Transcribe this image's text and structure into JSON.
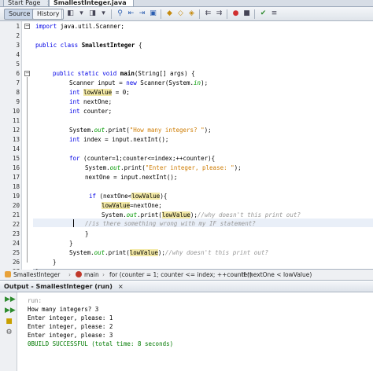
{
  "doc_tabs": [
    {
      "label": "Start Page",
      "close": "×"
    },
    {
      "label": "SmallestInteger.java",
      "close": "×"
    }
  ],
  "toolbar": {
    "source_label": "Source",
    "history_label": "History",
    "icons": [
      "back-icon",
      "forward-icon",
      "search-icon",
      "find-previous-icon",
      "find-next-icon",
      "toggle-highlight-icon",
      "bookmark-previous-icon",
      "bookmark-next-icon",
      "toggle-bookmark-icon",
      "shift-left-icon",
      "shift-right-icon",
      "record-macro-icon",
      "stop-macro-icon",
      "comment-icon",
      "uncomment-icon"
    ]
  },
  "editor": {
    "line_numbers": [
      "1",
      "2",
      "3",
      "4",
      "5",
      "6",
      "7",
      "8",
      "9",
      "10",
      "11",
      "12",
      "13",
      "14",
      "15",
      "16",
      "17",
      "18",
      "19",
      "20",
      "21",
      "22",
      "23",
      "24",
      "25",
      "26",
      "27"
    ]
  },
  "code": {
    "l1": {
      "kw": "import",
      "rest": " java.util.Scanner;"
    },
    "l3": {
      "kw": "public class",
      "name": " SmallestInteger ",
      "brace": "{"
    },
    "l6": {
      "kw": "public static void",
      "name": " main",
      "rest": "(String[] args) {"
    },
    "l7": {
      "a": "Scanner input = ",
      "kw": "new",
      "b": " Scanner(System.",
      "fld": "in",
      "c": ");"
    },
    "l8": {
      "kw": "int",
      "hl": "lowValue",
      "rest": " = 0;"
    },
    "l9": {
      "kw": "int",
      "rest": " nextOne;"
    },
    "l10": {
      "kw": "int",
      "rest": " counter;"
    },
    "l12": {
      "a": "System.",
      "fld": "out",
      "b": ".print(",
      "str": "\"How many integers? \"",
      "c": ");"
    },
    "l13": {
      "kw": "int",
      "rest": " index = input.nextInt();"
    },
    "l15": {
      "kw": "for",
      "rest": " (counter=1;counter<=index;++counter){"
    },
    "l16": {
      "a": "System.",
      "fld": "out",
      "b": ".print(",
      "str": "\"Enter integer, please: \"",
      "c": ");"
    },
    "l17": {
      "rest": "nextOne = input.nextInt();"
    },
    "l19": {
      "kw": "if",
      "a": " (nextOne<",
      "hl": "lowValue",
      "b": "){"
    },
    "l20": {
      "hl": "lowValue",
      "rest": "=nextOne;"
    },
    "l21": {
      "a": "System.",
      "fld": "out",
      "b": ".print(",
      "hl": "lowValue",
      "c": ");",
      "cmt": "//why doesn't this print out?"
    },
    "l22": {
      "cmt": "//is there something wrong with my IF statement?"
    },
    "l23": {
      "brace": "}"
    },
    "l24": {
      "brace": "}"
    },
    "l25": {
      "a": "System.",
      "fld": "out",
      "b": ".print(",
      "hl": "lowValue",
      "c": ");",
      "cmt": "//why doesn't this print out?"
    },
    "l26": {
      "brace": "}"
    },
    "l27": {
      "brace": "}"
    }
  },
  "breadcrumb": [
    {
      "label": "SmallestInteger",
      "icon": "class-icon",
      "color": "#e8a23a"
    },
    {
      "label": "main",
      "icon": "method-icon",
      "color": "#c0392b"
    },
    {
      "label": "for (counter = 1; counter <= index; ++counter)",
      "icon": "",
      "color": ""
    },
    {
      "label": "if (nextOne < lowValue)",
      "icon": "",
      "color": ""
    }
  ],
  "output": {
    "title": "Output - SmallestInteger (run)",
    "close": "×",
    "tools": [
      "rerun-icon",
      "rerun-with-params-icon",
      "stop-icon",
      "settings-icon"
    ],
    "lines": [
      "run:",
      "How many integers? 3",
      "Enter integer, please: 1",
      "Enter integer, please: 2",
      "Enter integer, please: 3",
      "0BUILD SUCCESSFUL (total time: 8 seconds)"
    ]
  },
  "colors": {
    "keyword": "#0000e6",
    "string": "#ce7b00",
    "field": "#009900",
    "comment": "#969696",
    "highlight": "#f3e9a6",
    "current_line": "#e9eff8"
  }
}
